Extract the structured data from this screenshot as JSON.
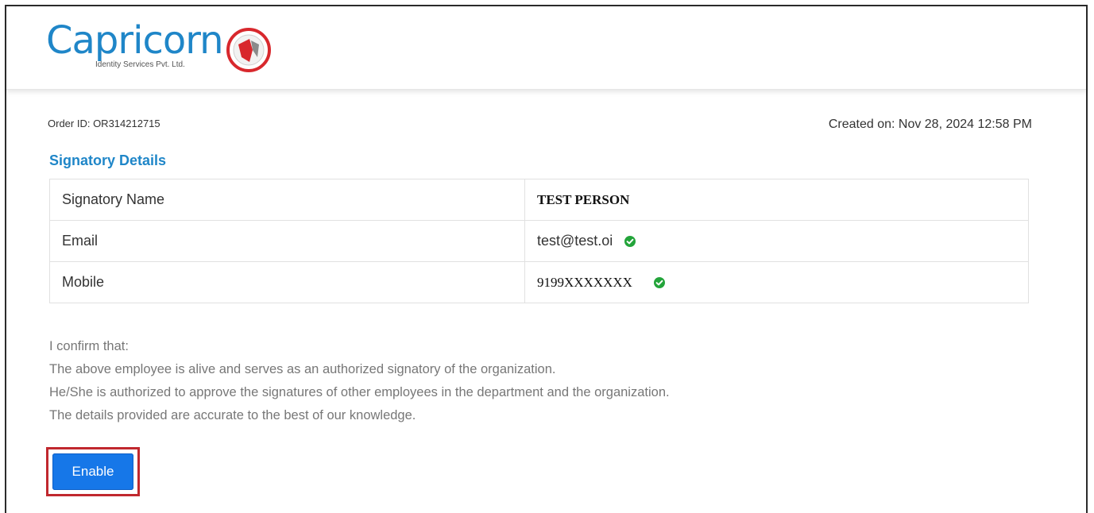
{
  "brand": {
    "name": "Capricorn",
    "subtitle": "Identity Services Pvt. Ltd.",
    "logo_icon": "capricorn-mark-icon",
    "color": "#1f86c8",
    "mark_color": "#d8282d"
  },
  "order": {
    "order_id": "Order ID: OR314212715",
    "created_on": "Created on: Nov 28, 2024 12:58 PM"
  },
  "section": {
    "title": "Signatory Details"
  },
  "details": {
    "rows": [
      {
        "label": "Signatory Name",
        "value": "TEST PERSON",
        "verified": false
      },
      {
        "label": "Email",
        "value": "test@test.oi",
        "verified": true
      },
      {
        "label": "Mobile",
        "value": "9199XXXXXXX",
        "verified": true
      }
    ],
    "verified_icon": "check-circle-icon",
    "verified_color": "#23a43a"
  },
  "confirmation": {
    "lines": [
      "I confirm that:",
      "The above employee is alive and serves as an authorized signatory of the organization.",
      "He/She is authorized to approve the signatures of other employees in the department and the organization.",
      "The details provided are accurate to the best of our knowledge."
    ]
  },
  "actions": {
    "enable_label": "Enable",
    "button_color": "#1677e8",
    "highlight_color": "#c0282e"
  }
}
